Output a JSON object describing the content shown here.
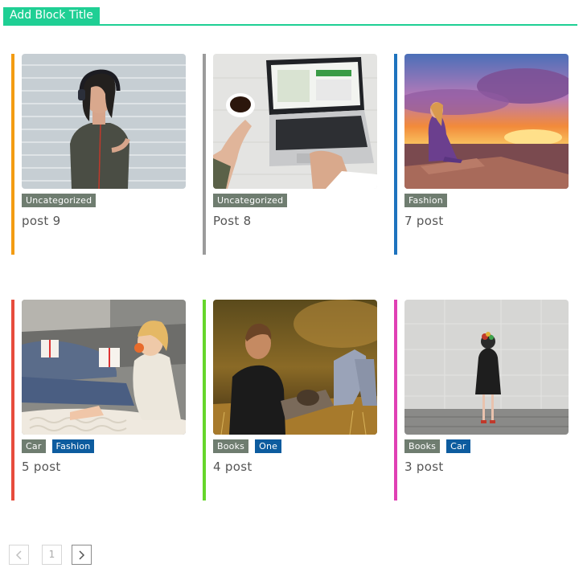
{
  "block": {
    "title": "Add Block Title",
    "accent": "#1fcf94"
  },
  "category_colors": {
    "gray_green": "#6f7d70",
    "blue": "#0d5c9f"
  },
  "posts": [
    {
      "title": "post 9",
      "bar_color": "#f39c12",
      "image": "woman-headphones-brick-wall",
      "categories": [
        "Uncategorized"
      ]
    },
    {
      "title": "Post 8",
      "bar_color": "#9b9b9b",
      "image": "laptop-coffee-desk",
      "categories": [
        "Uncategorized"
      ]
    },
    {
      "title": "7 post",
      "bar_color": "#1e73be",
      "image": "woman-sitting-sunset",
      "categories": [
        "Fashion"
      ]
    },
    {
      "title": "5 post",
      "bar_color": "#e74c3c",
      "image": "child-eating-gifts",
      "categories": [
        "Car",
        "Fashion"
      ]
    },
    {
      "title": "4 post",
      "bar_color": "#66d62b",
      "image": "couple-sitting-grass",
      "categories": [
        "Books",
        "One"
      ]
    },
    {
      "title": "3 post",
      "bar_color": "#e040b4",
      "image": "woman-stone-wall",
      "categories": [
        "Books",
        "Car"
      ]
    }
  ],
  "pagination": {
    "prev_icon": "chevron-left-icon",
    "page": "1",
    "next_icon": "chevron-right-icon"
  }
}
